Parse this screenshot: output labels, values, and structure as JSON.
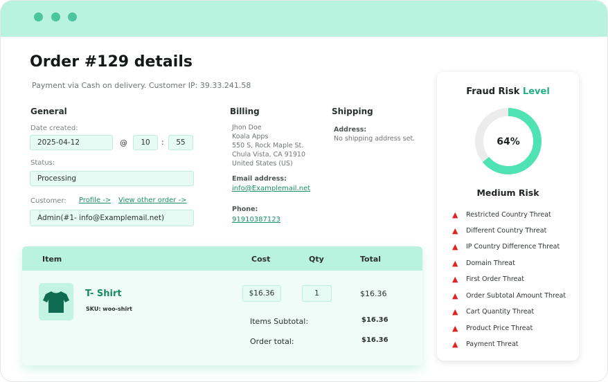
{
  "colors": {
    "accent": "#25b07f",
    "mint_light": "#b9f3e0",
    "field_bg": "#e6fbf3",
    "danger": "#e32222",
    "shirt": "#0f6b52"
  },
  "order": {
    "title": "Order #129 details",
    "subtitle": "Payment via Cash on delivery. Customer IP: 39.33.241.58"
  },
  "general": {
    "heading": "General",
    "date_label": "Date created:",
    "date": "2025-04-12",
    "at": "@",
    "hour": "10",
    "colon": ":",
    "minute": "55",
    "status_label": "Status:",
    "status": "Processing",
    "customer_label": "Customer:",
    "profile_link": "Profile ->",
    "other_order_link": "View other order ->",
    "customer": "Admin(#1- info@Examplemail.net)"
  },
  "billing": {
    "heading": "Billing",
    "address": [
      "Jhon Doe",
      "Koala Apps",
      "550 S, Rock Maple St.",
      "Chula Vista, CA 91910",
      "United States (US)"
    ],
    "email_label": "Email address:",
    "email": "info@Examplemail.net",
    "phone_label": "Phone:",
    "phone": "91910387123"
  },
  "shipping": {
    "heading": "Shipping",
    "address_label": "Address:",
    "address": "No shipping address set."
  },
  "items": {
    "columns": {
      "item": "Item",
      "cost": "Cost",
      "qty": "Qty",
      "total": "Total"
    },
    "product": {
      "name": "T- Shirt",
      "sku": "SKU: woo-shirt",
      "cost": "$16.36",
      "qty": "1",
      "total": "$16.36"
    },
    "subtotal_label": "Items Subtotal:",
    "subtotal": "$16.36",
    "order_total_label": "Order total:",
    "order_total": "$16.36"
  },
  "fraud": {
    "title_prefix": "Fraud Risk",
    "title_accent": "Level",
    "percent": 64,
    "percent_label": "64%",
    "risk_label": "Medium Risk",
    "threats": [
      "Restricted Country Threat",
      "Different Country Threat",
      "IP Country Difference Threat",
      "Domain Threat",
      "First Order Threat",
      "Order Subtotal Amount Threat",
      "Cart Quantity Threat",
      "Product Price Threat",
      "Payment Threat"
    ]
  }
}
